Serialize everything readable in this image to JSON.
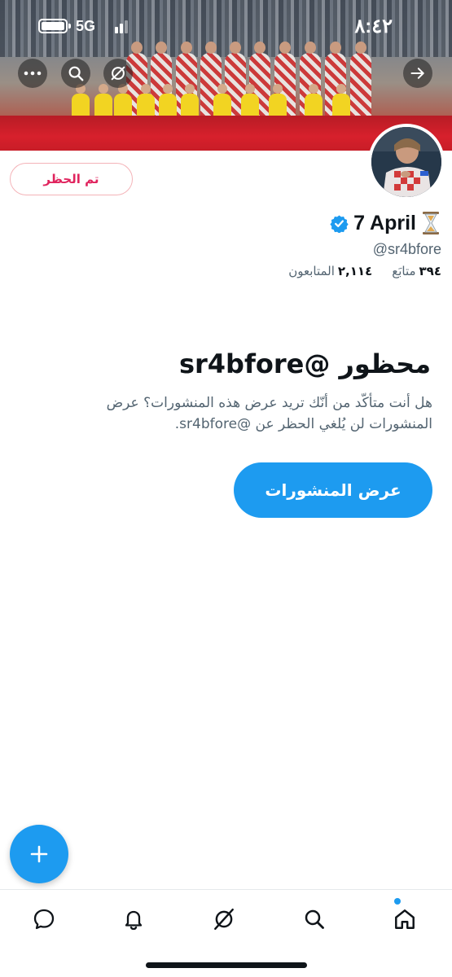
{
  "status_bar": {
    "network": "5G",
    "time": "٨:٤٢"
  },
  "profile": {
    "blocked_button_label": "تم الحظر",
    "name": "7 April",
    "handle": "@sr4bfore",
    "followers_count": "٢,١١٤",
    "followers_label": "المتابعون",
    "following_count": "٣٩٤",
    "following_label": "متابَع"
  },
  "blocked_notice": {
    "title": "محظور @sr4bfore",
    "description": "هل أنت متأكّد من أنّك تريد عرض هذه المنشورات؟ عرض المنشورات لن يُلغي الحظر عن @sr4bfore.",
    "view_posts_label": "عرض المنشورات"
  },
  "header_icons": [
    "back-arrow-icon",
    "grok-icon",
    "search-icon",
    "more-icon"
  ],
  "tabbar": {
    "items": [
      "home-icon",
      "search-icon",
      "grok-icon",
      "notifications-icon",
      "messages-icon"
    ],
    "active": "home-icon"
  },
  "colors": {
    "accent": "#1d9bf0",
    "blocked_red": "#e0245e",
    "verified": "#1d9bf0"
  }
}
